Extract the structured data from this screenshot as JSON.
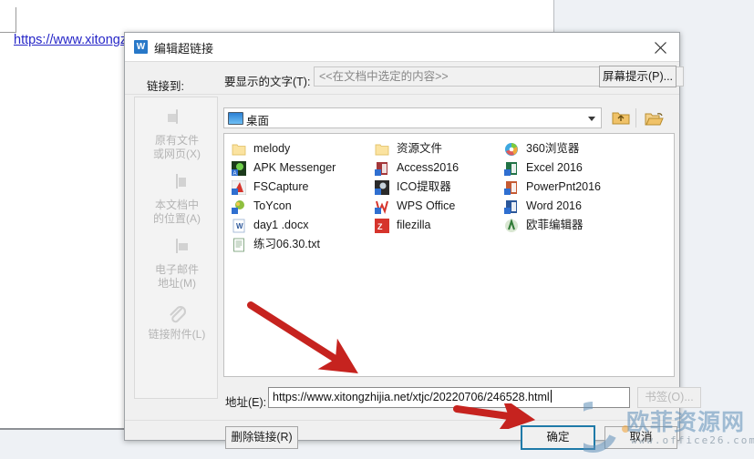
{
  "document": {
    "hyperlink_text": "https://www.xitongz"
  },
  "dialog": {
    "title": "编辑超链接",
    "title_icon": "wps-writer-icon",
    "close_icon": "close-icon",
    "display_text": {
      "label": "要显示的文字(T):",
      "placeholder": "<<在文档中选定的内容>>",
      "value": ""
    },
    "screen_tip_button": "屏幕提示(P)...",
    "link_to_label": "链接到:",
    "sidebar": {
      "items": [
        {
          "label_line1": "原有文件",
          "label_line2": "或网页(X)",
          "icon": "existing-file-icon",
          "selected": false
        },
        {
          "label_line1": "本文档中",
          "label_line2": "的位置(A)",
          "icon": "place-in-document-icon",
          "selected": false
        },
        {
          "label_line1": "电子邮件",
          "label_line2": "地址(M)",
          "icon": "email-address-icon",
          "selected": false
        },
        {
          "label_line1": "链接附件(L)",
          "label_line2": "",
          "icon": "paperclip-icon",
          "selected": false
        }
      ]
    },
    "location": {
      "value": "桌面",
      "icon": "desktop-monitor-icon",
      "dropdown_icon": "chevron-down-icon",
      "up_button_icon": "up-one-level-folder-icon",
      "browse_button_icon": "browse-folder-icon"
    },
    "file_list": {
      "columns": [
        [
          {
            "name": "melody",
            "icon": "folder-icon"
          },
          {
            "name": "APK Messenger",
            "icon": "apk-messenger-icon"
          },
          {
            "name": "FSCapture",
            "icon": "fscapture-icon"
          },
          {
            "name": "ToYcon",
            "icon": "toycon-icon"
          },
          {
            "name": "day1 .docx",
            "icon": "word-document-icon"
          },
          {
            "name": "练习06.30.txt",
            "icon": "text-document-icon"
          }
        ],
        [
          {
            "name": "资源文件",
            "icon": "folder-icon"
          },
          {
            "name": "Access2016",
            "icon": "access-icon"
          },
          {
            "name": "ICO提取器",
            "icon": "ico-extractor-icon"
          },
          {
            "name": "WPS Office",
            "icon": "wps-office-icon"
          },
          {
            "name": "filezilla",
            "icon": "filezilla-icon"
          }
        ],
        [
          {
            "name": "360浏览器",
            "icon": "360-browser-icon"
          },
          {
            "name": "Excel 2016",
            "icon": "excel-icon"
          },
          {
            "name": "PowerPnt2016",
            "icon": "powerpoint-icon"
          },
          {
            "name": "Word 2016",
            "icon": "word-icon"
          },
          {
            "name": "欧菲编辑器",
            "icon": "oufei-editor-icon"
          }
        ]
      ]
    },
    "address": {
      "label": "地址(E):",
      "value": "https://www.xitongzhijia.net/xtjc/20220706/246528.html"
    },
    "bookmark_button": "书签(O)...",
    "footer": {
      "remove_link": "删除链接(R)",
      "ok": "确定",
      "cancel": "取消"
    }
  },
  "annotations": {
    "arrow_color": "#c6231f",
    "arrow_to_address": "red-arrow-icon",
    "arrow_to_ok": "red-arrow-icon"
  },
  "watermark": {
    "text": "欧菲资源网",
    "url": "www.office26.com",
    "color": "#5f8fb8"
  }
}
